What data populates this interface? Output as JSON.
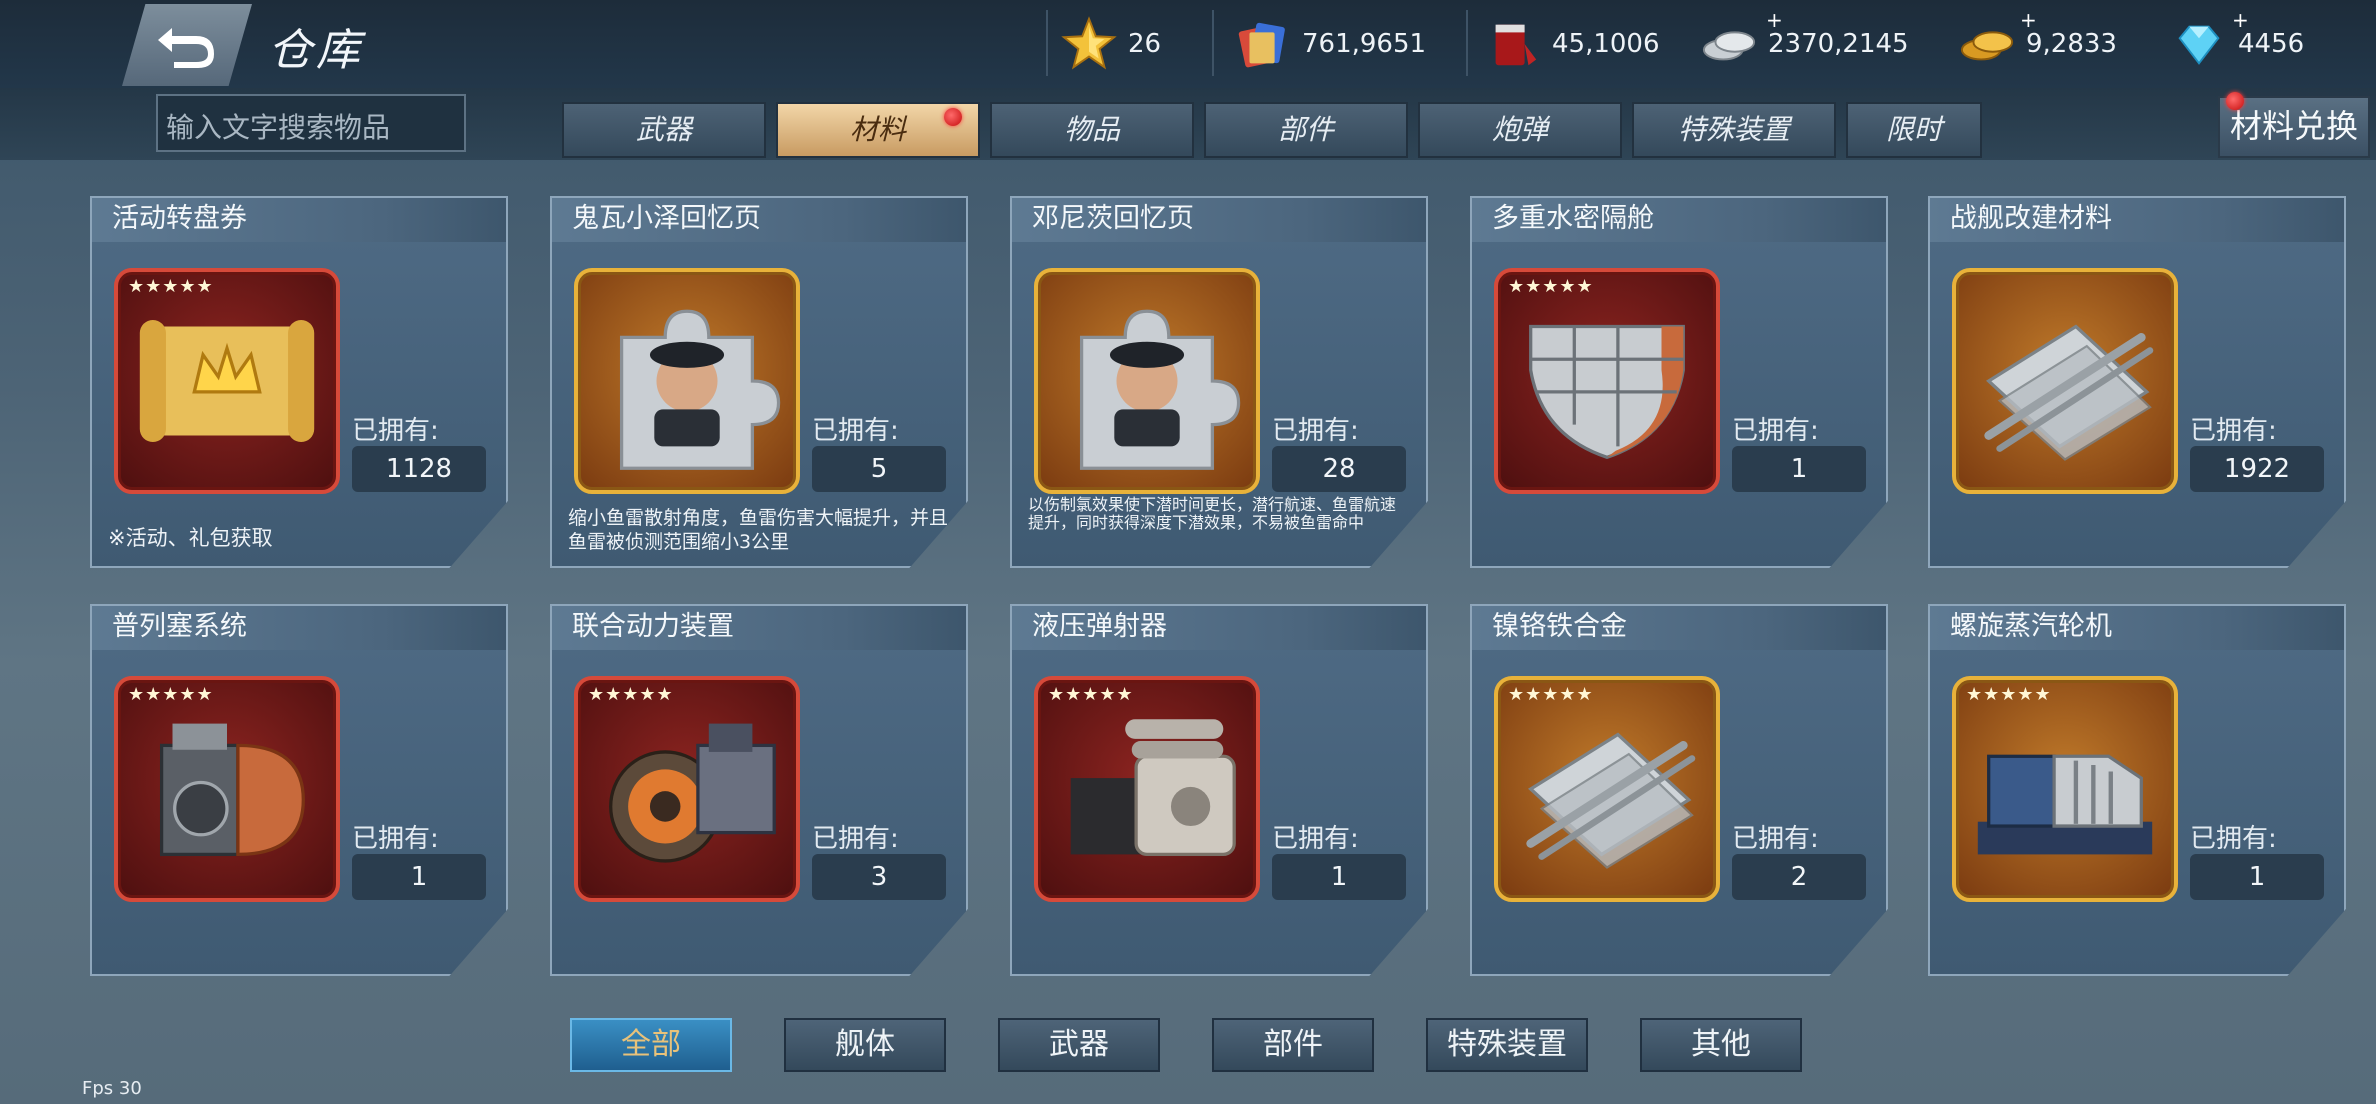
{
  "header": {
    "title": "仓库",
    "resources": [
      {
        "icon": "star-icon",
        "value": "26"
      },
      {
        "icon": "card-pack-icon",
        "value": "761,9651"
      },
      {
        "icon": "paint-bucket-icon",
        "value": "45,1006"
      },
      {
        "icon": "silver-coins-icon",
        "value": "2370,2145"
      },
      {
        "icon": "gold-coins-icon",
        "value": "9,2833"
      },
      {
        "icon": "diamond-icon",
        "value": "4456"
      }
    ]
  },
  "search": {
    "placeholder": "输入文字搜索物品"
  },
  "tabs": [
    "武器",
    "材料",
    "物品",
    "部件",
    "炮弹",
    "特殊装置",
    "限时"
  ],
  "active_tab": "材料",
  "exchange_label": "材料兑换",
  "owned_label": "已拥有:",
  "items": [
    {
      "name": "活动转盘券",
      "count": "1128",
      "rarity": "red",
      "stars": "★★★★★",
      "icon": "scroll-crown-icon",
      "desc": "※活动、礼包获取"
    },
    {
      "name": "鬼瓦小泽回忆页",
      "count": "5",
      "rarity": "gold",
      "stars": "",
      "icon": "puzzle-portrait-icon",
      "desc": "缩小鱼雷散射角度，鱼雷伤害大幅提升，并且鱼雷被侦测范围缩小3公里"
    },
    {
      "name": "邓尼茨回忆页",
      "count": "28",
      "rarity": "gold",
      "stars": "",
      "icon": "puzzle-portrait-icon",
      "desc": "以伤制氯效果使下潜时间更长，潜行航速、鱼雷航速提升，同时获得深度下潜效果，不易被鱼雷命中"
    },
    {
      "name": "多重水密隔舱",
      "count": "1",
      "rarity": "red",
      "stars": "★★★★★",
      "icon": "hull-compartment-icon",
      "desc": ""
    },
    {
      "name": "战舰改建材料",
      "count": "1922",
      "rarity": "gold",
      "stars": "",
      "icon": "steel-plates-icon",
      "desc": ""
    },
    {
      "name": "普列塞系统",
      "count": "1",
      "rarity": "red",
      "stars": "★★★★★",
      "icon": "mechanical-system-icon",
      "desc": ""
    },
    {
      "name": "联合动力装置",
      "count": "3",
      "rarity": "red",
      "stars": "★★★★★",
      "icon": "turbine-engine-icon",
      "desc": ""
    },
    {
      "name": "液压弹射器",
      "count": "1",
      "rarity": "red",
      "stars": "★★★★★",
      "icon": "hydraulic-machine-icon",
      "desc": ""
    },
    {
      "name": "镍铬铁合金",
      "count": "2",
      "rarity": "gold",
      "stars": "★★★★★",
      "icon": "steel-plates-icon",
      "desc": ""
    },
    {
      "name": "螺旋蒸汽轮机",
      "count": "1",
      "rarity": "gold",
      "stars": "★★★★★",
      "icon": "steam-turbine-icon",
      "desc": ""
    }
  ],
  "filters": [
    "全部",
    "舰体",
    "武器",
    "部件",
    "特殊装置",
    "其他"
  ],
  "active_filter": "全部",
  "fps": "Fps 30",
  "colors": {
    "active_tab": "#e0b98a",
    "active_filter": "#2d7fb5",
    "red_frame": "#d64a3a",
    "gold_frame": "#e8b23a"
  }
}
